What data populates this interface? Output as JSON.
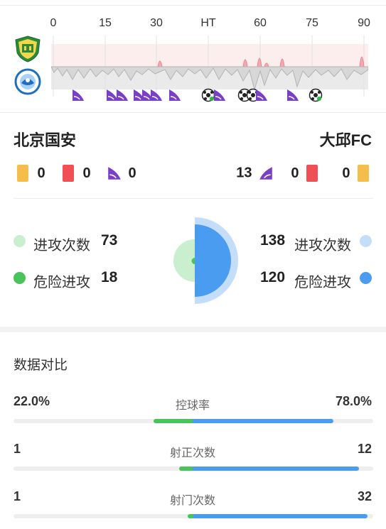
{
  "timeline": {
    "ticks": [
      "0",
      "15",
      "30",
      "HT",
      "60",
      "75",
      "90"
    ]
  },
  "teams": {
    "home": {
      "name": "北京国安",
      "logo_icon": "beijing-guoan-logo"
    },
    "away": {
      "name": "大邱FC",
      "logo_icon": "daegu-fc-logo"
    }
  },
  "counts": {
    "home": {
      "yellow": "0",
      "red": "0",
      "corners": "0"
    },
    "away": {
      "corners": "13",
      "red": "0",
      "yellow": "0"
    }
  },
  "attack": {
    "home": {
      "attacks_label": "进攻次数",
      "attacks": "73",
      "dangerous_label": "危险进攻",
      "dangerous": "18"
    },
    "away": {
      "attacks": "138",
      "attacks_label": "进攻次数",
      "dangerous": "120",
      "dangerous_label": "危险进攻"
    }
  },
  "comparison": {
    "title": "数据对比",
    "rows": [
      {
        "home": "22.0%",
        "label": "控球率",
        "away": "78.0%"
      },
      {
        "home": "1",
        "label": "射正次数",
        "away": "12"
      },
      {
        "home": "1",
        "label": "射门次数",
        "away": "32"
      }
    ]
  },
  "colors": {
    "home_accent": "#49c45a",
    "home_light": "#c9efcf",
    "away_accent": "#4a9cf0",
    "away_light": "#c4def9",
    "corner_purple": "#7a3fc9",
    "yellow_card": "#f5be4b",
    "red_card": "#ef4f55"
  }
}
